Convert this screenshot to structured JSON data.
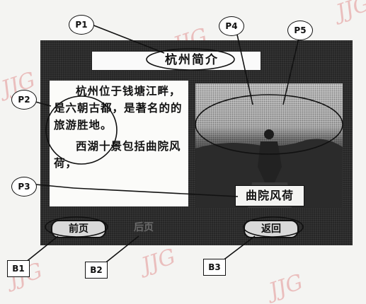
{
  "screen": {
    "title": "杭州简介",
    "paragraph_1": "杭州位于钱塘江畔，是六朝古都，是著名的的旅游胜地。",
    "paragraph_2": "西湖十景包括曲院风荷，",
    "photo_caption": "曲院风荷"
  },
  "buttons": {
    "b1_label": "前页",
    "b2_label": "后页",
    "b3_label": "返回"
  },
  "callouts": {
    "p1": "P1",
    "p2": "P2",
    "p3": "P3",
    "p4": "P4",
    "p5": "P5",
    "b1": "B1",
    "b2": "B2",
    "b3": "B3"
  },
  "watermark": "JJG",
  "colors": {
    "screen_bg": "#262626",
    "panel_bg": "#fbfbf9",
    "watermark": "#e7a8a8"
  }
}
